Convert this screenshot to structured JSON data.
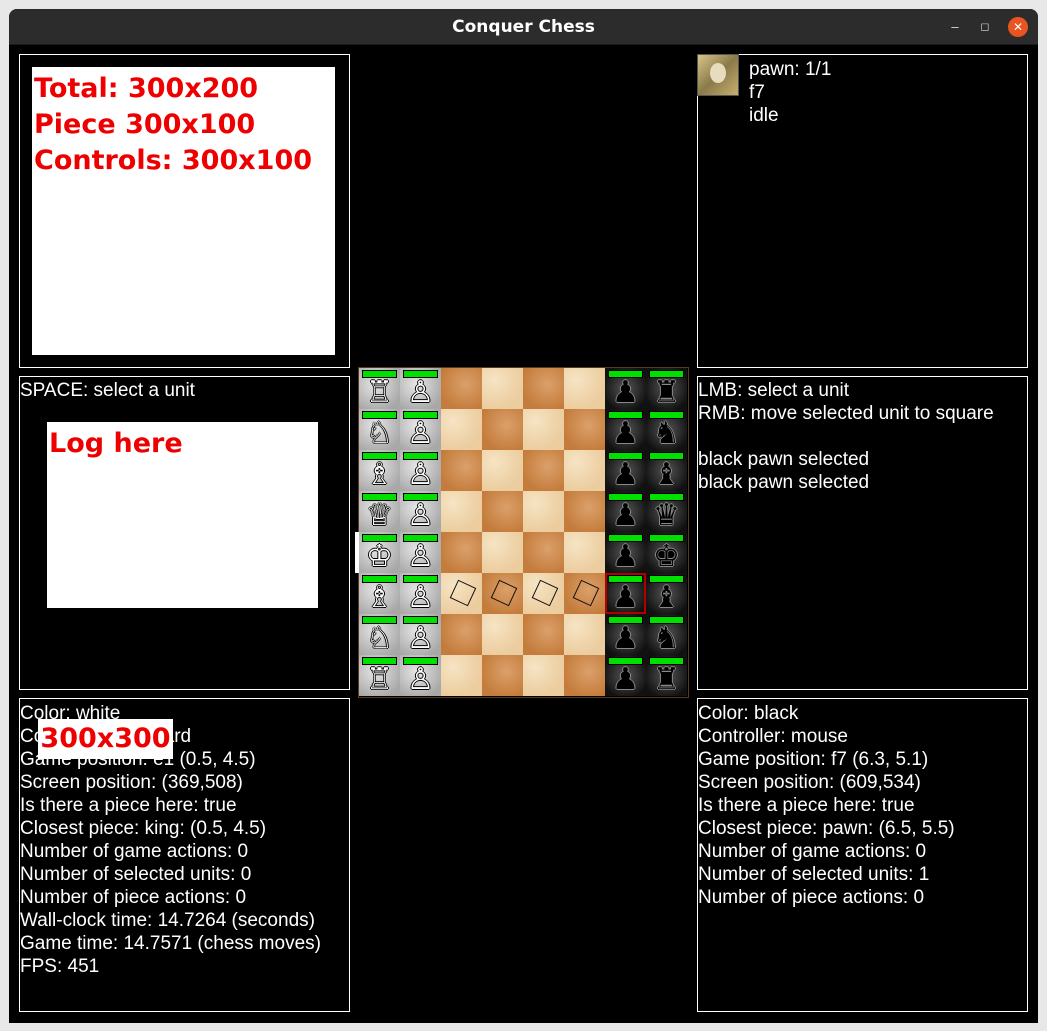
{
  "window": {
    "title": "Conquer Chess",
    "min_glyph": "–",
    "max_glyph": "◻",
    "close_glyph": "✕"
  },
  "top_left_note": {
    "lines": [
      "Total: 300x200",
      "Piece 300x100",
      "Controls: 300x100"
    ]
  },
  "left_controls": {
    "hint": "SPACE: select a unit"
  },
  "log_note": {
    "text": "Log here"
  },
  "size_note": {
    "text": "300x300"
  },
  "right_unit": {
    "name": "pawn: 1/1",
    "square": "f7",
    "state": "idle"
  },
  "right_controls": {
    "lines": [
      "LMB: select a unit",
      "RMB: move selected unit to square",
      "",
      "black pawn selected",
      "black pawn selected"
    ]
  },
  "white_info": {
    "lines": [
      "Color: white",
      "Controller: keyboard",
      "Game position: e1 (0.5, 4.5)",
      "Screen position: (369,508)",
      "Is there a piece here: true",
      "Closest piece: king: (0.5, 4.5)",
      "Number of game actions: 0",
      "Number of selected units: 0",
      "Number of piece actions: 0",
      "Wall-clock time: 14.7264 (seconds)",
      "Game time: 14.7571 (chess moves)",
      "FPS: 451"
    ]
  },
  "black_info": {
    "lines": [
      "Color: black",
      "Controller: mouse",
      "Game position: f7 (6.3, 5.1)",
      "Screen position: (609,534)",
      "Is there a piece here: true",
      "Closest piece: pawn: (6.5, 5.5)",
      "Number of game actions: 0",
      "Number of selected units: 1",
      "Number of piece actions: 0"
    ]
  },
  "colors": {
    "note_text": "#ee0000",
    "health_bar": "#00e000",
    "close_button": "#e95420"
  },
  "board": {
    "orientation": "white on the left, black on the right",
    "pieces": [
      {
        "file": "a",
        "rank": 1,
        "piece": "rook",
        "color": "white",
        "glyph": "♖",
        "health": 1.0
      },
      {
        "file": "b",
        "rank": 1,
        "piece": "pawn",
        "color": "white",
        "glyph": "♙",
        "health": 1.0
      },
      {
        "file": "g",
        "rank": 1,
        "piece": "pawn",
        "color": "black",
        "glyph": "♟",
        "health": 1.0
      },
      {
        "file": "h",
        "rank": 1,
        "piece": "rook",
        "color": "black",
        "glyph": "♜",
        "health": 1.0
      },
      {
        "file": "a",
        "rank": 2,
        "piece": "knight",
        "color": "white",
        "glyph": "♘",
        "health": 1.0
      },
      {
        "file": "b",
        "rank": 2,
        "piece": "pawn",
        "color": "white",
        "glyph": "♙",
        "health": 1.0
      },
      {
        "file": "g",
        "rank": 2,
        "piece": "pawn",
        "color": "black",
        "glyph": "♟",
        "health": 1.0
      },
      {
        "file": "h",
        "rank": 2,
        "piece": "knight",
        "color": "black",
        "glyph": "♞",
        "health": 1.0
      },
      {
        "file": "a",
        "rank": 3,
        "piece": "bishop",
        "color": "white",
        "glyph": "♗",
        "health": 1.0
      },
      {
        "file": "b",
        "rank": 3,
        "piece": "pawn",
        "color": "white",
        "glyph": "♙",
        "health": 1.0
      },
      {
        "file": "g",
        "rank": 3,
        "piece": "pawn",
        "color": "black",
        "glyph": "♟",
        "health": 1.0
      },
      {
        "file": "h",
        "rank": 3,
        "piece": "bishop",
        "color": "black",
        "glyph": "♝",
        "health": 1.0
      },
      {
        "file": "a",
        "rank": 4,
        "piece": "queen",
        "color": "white",
        "glyph": "♕",
        "health": 1.0
      },
      {
        "file": "b",
        "rank": 4,
        "piece": "pawn",
        "color": "white",
        "glyph": "♙",
        "health": 1.0
      },
      {
        "file": "g",
        "rank": 4,
        "piece": "pawn",
        "color": "black",
        "glyph": "♟",
        "health": 1.0
      },
      {
        "file": "h",
        "rank": 4,
        "piece": "queen",
        "color": "black",
        "glyph": "♛",
        "health": 1.0
      },
      {
        "file": "a",
        "rank": 5,
        "piece": "king",
        "color": "white",
        "glyph": "♔",
        "health": 1.0,
        "cursor": true
      },
      {
        "file": "b",
        "rank": 5,
        "piece": "pawn",
        "color": "white",
        "glyph": "♙",
        "health": 1.0
      },
      {
        "file": "g",
        "rank": 5,
        "piece": "pawn",
        "color": "black",
        "glyph": "♟",
        "health": 1.0
      },
      {
        "file": "h",
        "rank": 5,
        "piece": "king",
        "color": "black",
        "glyph": "♚",
        "health": 1.0
      },
      {
        "file": "a",
        "rank": 6,
        "piece": "bishop",
        "color": "white",
        "glyph": "♗",
        "health": 1.0
      },
      {
        "file": "b",
        "rank": 6,
        "piece": "pawn",
        "color": "white",
        "glyph": "♙",
        "health": 1.0
      },
      {
        "file": "g",
        "rank": 6,
        "piece": "pawn",
        "color": "black",
        "glyph": "♟",
        "health": 1.0,
        "selected": true
      },
      {
        "file": "h",
        "rank": 6,
        "piece": "bishop",
        "color": "black",
        "glyph": "♝",
        "health": 1.0
      },
      {
        "file": "a",
        "rank": 7,
        "piece": "knight",
        "color": "white",
        "glyph": "♘",
        "health": 1.0
      },
      {
        "file": "b",
        "rank": 7,
        "piece": "pawn",
        "color": "white",
        "glyph": "♙",
        "health": 1.0
      },
      {
        "file": "g",
        "rank": 7,
        "piece": "pawn",
        "color": "black",
        "glyph": "♟",
        "health": 1.0
      },
      {
        "file": "h",
        "rank": 7,
        "piece": "knight",
        "color": "black",
        "glyph": "♞",
        "health": 1.0
      },
      {
        "file": "a",
        "rank": 8,
        "piece": "rook",
        "color": "white",
        "glyph": "♖",
        "health": 1.0
      },
      {
        "file": "b",
        "rank": 8,
        "piece": "pawn",
        "color": "white",
        "glyph": "♙",
        "health": 1.0
      },
      {
        "file": "g",
        "rank": 8,
        "piece": "pawn",
        "color": "black",
        "glyph": "♟",
        "health": 1.0
      },
      {
        "file": "h",
        "rank": 8,
        "piece": "rook",
        "color": "black",
        "glyph": "♜",
        "health": 1.0
      }
    ],
    "move_targets": [
      {
        "file": "c",
        "rank": 6
      },
      {
        "file": "d",
        "rank": 6
      },
      {
        "file": "e",
        "rank": 6
      },
      {
        "file": "f",
        "rank": 6
      }
    ]
  }
}
